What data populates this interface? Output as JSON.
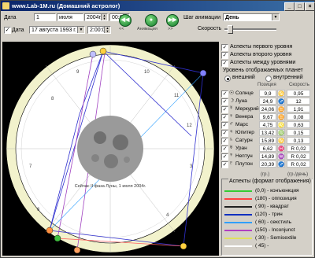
{
  "window": {
    "title": "www.Lab-1M.ru (Домашний астролог)"
  },
  "controls": {
    "date1_label": "Дата",
    "date1_day": "1",
    "date1_month": "июля",
    "date1_year": "2004г.",
    "date1_time": "00:00",
    "date2_label": "Дата",
    "date2_value": "17 августа 1993 г.",
    "date2_time": "2:00:00",
    "anim_left_label": "<<",
    "anim_center_label": "Анимация",
    "anim_right_label": ">>",
    "step_label": "Шаг анимации",
    "step_value": "День",
    "speed_label": "Скорость"
  },
  "aspects_levels": [
    {
      "label": "Аспекты первого уровня",
      "checked": true
    },
    {
      "label": "Аспекты второго уровня",
      "checked": true
    },
    {
      "label": "Аспекты между уровнями",
      "checked": true
    }
  ],
  "level_display": {
    "title": "Уровень отображаемых планет",
    "outer_label": "внешний",
    "inner_label": "внутренний",
    "selected": "внешний"
  },
  "planet_table": {
    "col_position": "Позиция",
    "col_speed": "Скорость",
    "rows": [
      {
        "glyph": "☉",
        "name": "Солнце",
        "position": "9,9",
        "sign": "♋",
        "speed": "0,95"
      },
      {
        "glyph": "☽",
        "name": "Луна",
        "position": "24,9",
        "sign": "♐",
        "speed": "12"
      },
      {
        "glyph": "☿",
        "name": "Меркурий",
        "position": "24,06",
        "sign": "♊",
        "speed": "1,91"
      },
      {
        "glyph": "♀",
        "name": "Венера",
        "position": "9,67",
        "sign": "♊",
        "speed": "0,08"
      },
      {
        "glyph": "♂",
        "name": "Марс",
        "position": "4,75",
        "sign": "♌",
        "speed": "0,63"
      },
      {
        "glyph": "♃",
        "name": "Юпитер",
        "position": "13,42",
        "sign": "♍",
        "speed": "0,15"
      },
      {
        "glyph": "♄",
        "name": "Сатурн",
        "position": "15,89",
        "sign": "♋",
        "speed": "0,13"
      },
      {
        "glyph": "♅",
        "name": "Уран",
        "position": "6,62",
        "sign": "♓",
        "speed": "R 0,02"
      },
      {
        "glyph": "♆",
        "name": "Нептун",
        "position": "14,89",
        "sign": "♒",
        "speed": "R 0,02"
      },
      {
        "glyph": "♇",
        "name": "Плутон",
        "position": "20,39",
        "sign": "♐",
        "speed": "R 0,02"
      }
    ],
    "foot_left": "(гр.)",
    "foot_right": "(гр./день)"
  },
  "aspects_format": {
    "title": "Аспекты (формат отображения)",
    "items": [
      {
        "text": "(0,0) - конъюнкция",
        "color": "#33cc33"
      },
      {
        "text": "(180) - оппозиция",
        "color": "#ff4040"
      },
      {
        "text": "( 90) - квадрат",
        "color": "#202020"
      },
      {
        "text": "(120) - трин",
        "color": "#1030c0"
      },
      {
        "text": "( 60) - секстиль",
        "color": "#30a0ff"
      },
      {
        "text": "(150) - Inconjunct",
        "color": "#b040c0"
      },
      {
        "text": "( 30) - Semisextile",
        "color": "#e0e060"
      },
      {
        "text": "( 45) -",
        "color": "#ffffff"
      }
    ]
  },
  "chart": {
    "caption": "Сейчас II фаза Луны, 1 июля 2004г.",
    "house_numbers": [
      "8",
      "7",
      "6",
      "4",
      "3",
      "9",
      "10",
      "11",
      "12"
    ],
    "colors": {
      "bg": "#000000",
      "ring": "#f2f2cc",
      "inner": "#ffffff",
      "aspect_blue": "#3030d0",
      "aspect_purple": "#a040c0"
    }
  }
}
